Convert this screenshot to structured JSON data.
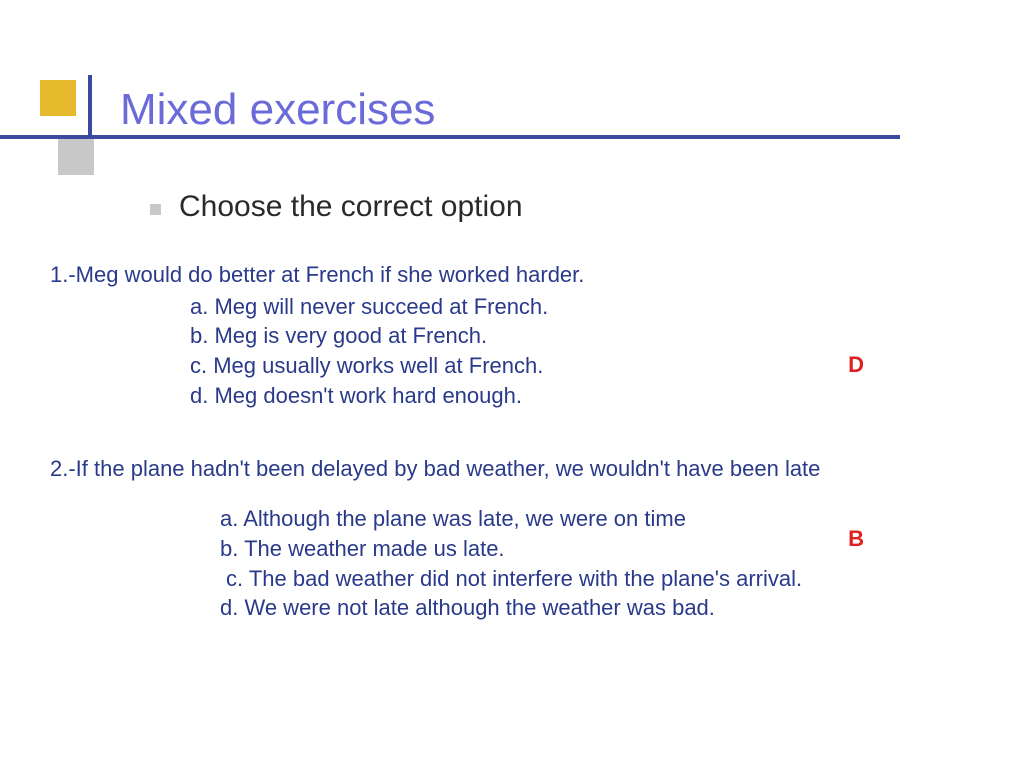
{
  "slide": {
    "title": "Mixed exercises",
    "subtitle": "Choose the correct option"
  },
  "questions": [
    {
      "stem": "1.-Meg would do better at French if she worked harder.",
      "options": {
        "a": "a. Meg will never succeed at French.",
        "b": "b. Meg is very good at French.",
        "c": "c. Meg usually works well at French.",
        "d": "d. Meg doesn't work hard enough."
      },
      "answer": "D"
    },
    {
      "stem": "2.-If the plane hadn't been delayed by bad weather, we wouldn't have been late",
      "options": {
        "a": "a. Although the plane was late, we were on time",
        "b": "b. The weather made us late.",
        "c": " c. The bad weather did not interfere with the plane's arrival.",
        "d": "d. We were not late although the weather was bad."
      },
      "answer": "B"
    }
  ]
}
